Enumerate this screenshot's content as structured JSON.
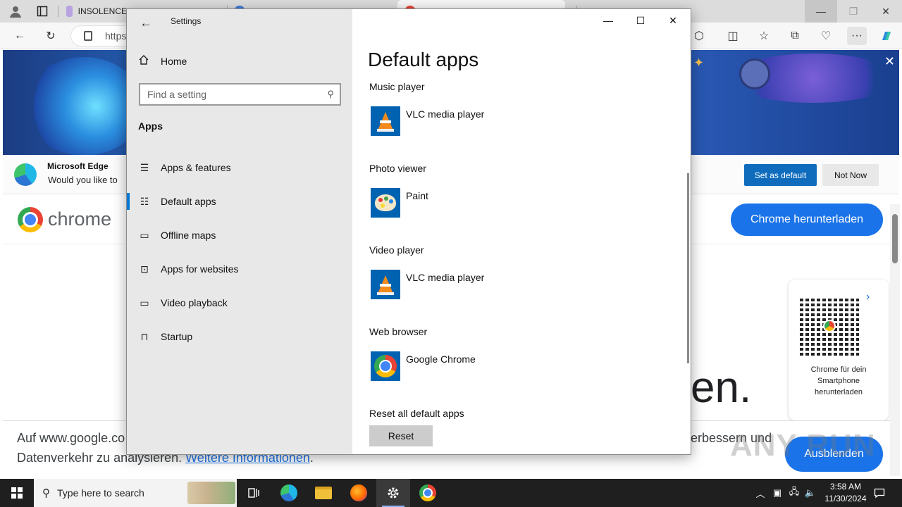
{
  "browser": {
    "tabs": [
      {
        "label": "INSOLENCE"
      },
      {
        "label": ""
      },
      {
        "label": ""
      }
    ],
    "address": "https",
    "edge_banner": {
      "title": "Microsoft Edge",
      "subtitle": "Would you like to",
      "set_default_label": "Set as default",
      "not_now_label": "Not Now"
    },
    "chrome_page": {
      "logo_text": "chrome",
      "download_label": "Chrome herunterladen",
      "qr_caption": "Chrome für dein Smartphone herunterladen",
      "big_fragment": "en.",
      "cookie_line1": "Auf www.google.co",
      "cookie_line1_end": "erbessern und",
      "cookie_line2": "Datenverkehr zu analysieren.",
      "cookie_link": "Weitere Informationen",
      "cookie_period": ".",
      "hide_label": "Ausblenden"
    },
    "watermark": "ANY RUN"
  },
  "settings": {
    "window_title": "Settings",
    "home_label": "Home",
    "search_placeholder": "Find a setting",
    "section_title": "Apps",
    "nav": [
      {
        "label": "Apps & features",
        "icon": "list-icon",
        "selected": false
      },
      {
        "label": "Default apps",
        "icon": "default-apps-icon",
        "selected": true
      },
      {
        "label": "Offline maps",
        "icon": "map-icon",
        "selected": false
      },
      {
        "label": "Apps for websites",
        "icon": "open-in-app-icon",
        "selected": false
      },
      {
        "label": "Video playback",
        "icon": "video-icon",
        "selected": false
      },
      {
        "label": "Startup",
        "icon": "startup-icon",
        "selected": false
      }
    ],
    "page_title": "Default apps",
    "groups": [
      {
        "label": "Music player",
        "app": "VLC media player",
        "icon": "vlc-icon"
      },
      {
        "label": "Photo viewer",
        "app": "Paint",
        "icon": "paint-icon"
      },
      {
        "label": "Video player",
        "app": "VLC media player",
        "icon": "vlc-icon"
      },
      {
        "label": "Web browser",
        "app": "Google Chrome",
        "icon": "chrome-icon"
      }
    ],
    "reset_label": "Reset all default apps",
    "reset_button": "Reset"
  },
  "taskbar": {
    "search_placeholder": "Type here to search",
    "time": "3:58 AM",
    "date": "11/30/2024"
  },
  "colors": {
    "accent": "#0078d4",
    "edge_button": "#0f6cbd",
    "chrome_blue": "#1a73e8",
    "taskbar": "#1f1f1f"
  }
}
